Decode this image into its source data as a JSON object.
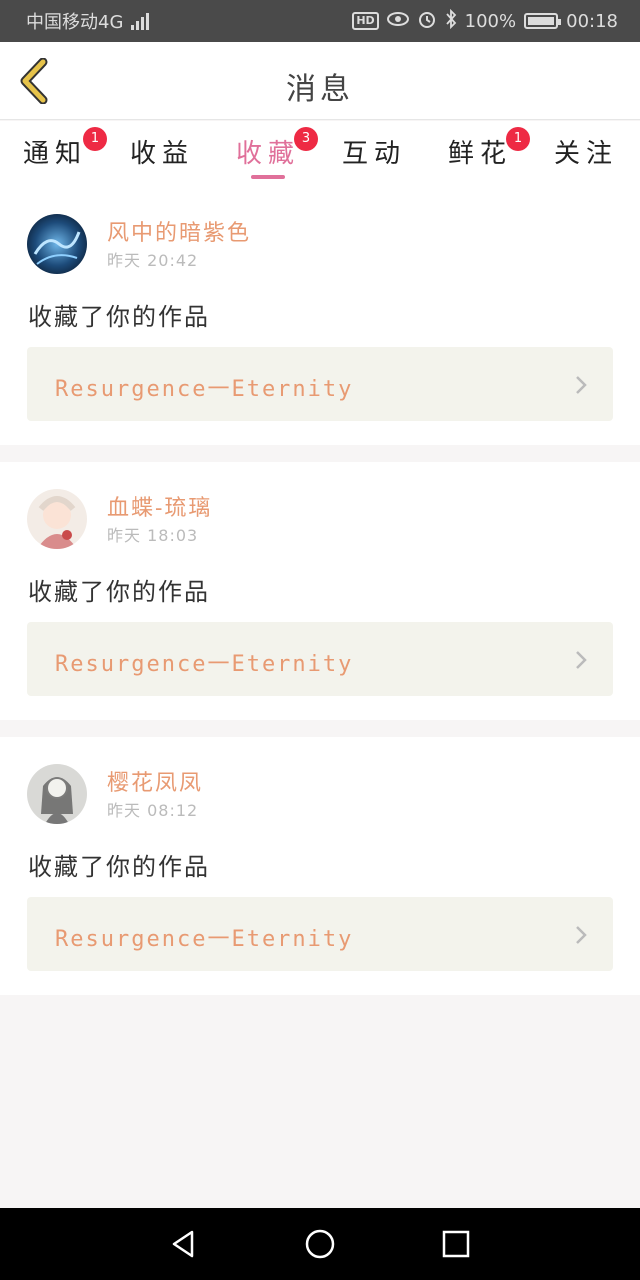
{
  "status_bar": {
    "carrier": "中国移动4G",
    "network_small": "4G",
    "hd": "HD",
    "battery_percent": "100%",
    "time": "00:18"
  },
  "header": {
    "title": "消息",
    "back_icon": "back-chevron-icon"
  },
  "tabs": [
    {
      "label": "通知",
      "badge": "1",
      "active": false
    },
    {
      "label": "收益",
      "badge": "",
      "active": false
    },
    {
      "label": "收藏",
      "badge": "3",
      "active": true
    },
    {
      "label": "互动",
      "badge": "",
      "active": false
    },
    {
      "label": "鲜花",
      "badge": "1",
      "active": false
    },
    {
      "label": "关注",
      "badge": "",
      "active": false
    }
  ],
  "items": [
    {
      "username": "风中的暗紫色",
      "time": "昨天 20:42",
      "action": "收藏了你的作品",
      "work_title": "Resurgence一Eternity"
    },
    {
      "username": "血蝶-琉璃",
      "time": "昨天 18:03",
      "action": "收藏了你的作品",
      "work_title": "Resurgence一Eternity"
    },
    {
      "username": "樱花凤凤",
      "time": "昨天 08:12",
      "action": "收藏了你的作品",
      "work_title": "Resurgence一Eternity"
    }
  ],
  "colors": {
    "accent_pink": "#e0709a",
    "name_orange": "#e89a72",
    "badge_red": "#ee2a44",
    "back_yellow": "#e6c34a"
  }
}
